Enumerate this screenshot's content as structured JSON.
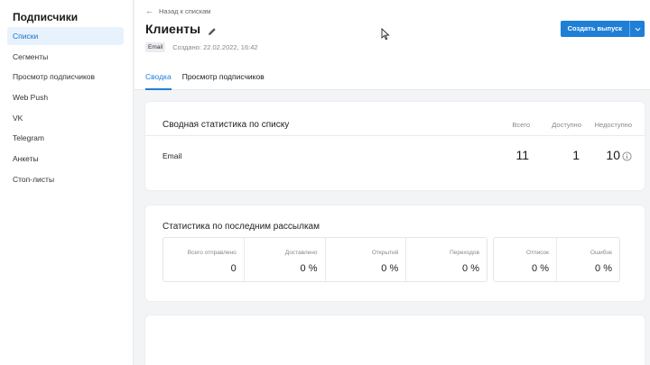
{
  "sidebar": {
    "title": "Подписчики",
    "items": [
      {
        "label": "Списки",
        "active": true
      },
      {
        "label": "Сегменты"
      },
      {
        "label": "Просмотр подписчиков"
      },
      {
        "label": "Web Push"
      },
      {
        "label": "VK"
      },
      {
        "label": "Telegram"
      },
      {
        "label": "Анкеты"
      },
      {
        "label": "Стоп-листы"
      }
    ]
  },
  "header": {
    "back_label": "Назад к спискам",
    "title": "Клиенты",
    "badge": "Email",
    "created": "Создано: 22.02.2022, 16:42",
    "create_button": "Создать выпуск",
    "tabs": [
      {
        "label": "Сводка",
        "active": true
      },
      {
        "label": "Просмотр подписчиков"
      }
    ]
  },
  "summary": {
    "title": "Сводная статистика по списку",
    "columns": [
      "Всего",
      "Доступно",
      "Недоступно"
    ],
    "row": {
      "label": "Email",
      "total": "11",
      "available": "1",
      "unavailable": "10"
    }
  },
  "campaigns": {
    "title": "Статистика по последним рассылкам",
    "group_a": [
      {
        "label": "Всего отправлено",
        "value": "0"
      },
      {
        "label": "Доставлено",
        "value": "0 %"
      },
      {
        "label": "Открытий",
        "value": "0 %"
      },
      {
        "label": "Переходов",
        "value": "0 %"
      }
    ],
    "group_b": [
      {
        "label": "Отписок",
        "value": "0 %"
      },
      {
        "label": "Ошибок",
        "value": "0 %"
      }
    ]
  },
  "colors": {
    "accent": "#1f7fd7",
    "active_nav_bg": "#e8f2fc"
  }
}
